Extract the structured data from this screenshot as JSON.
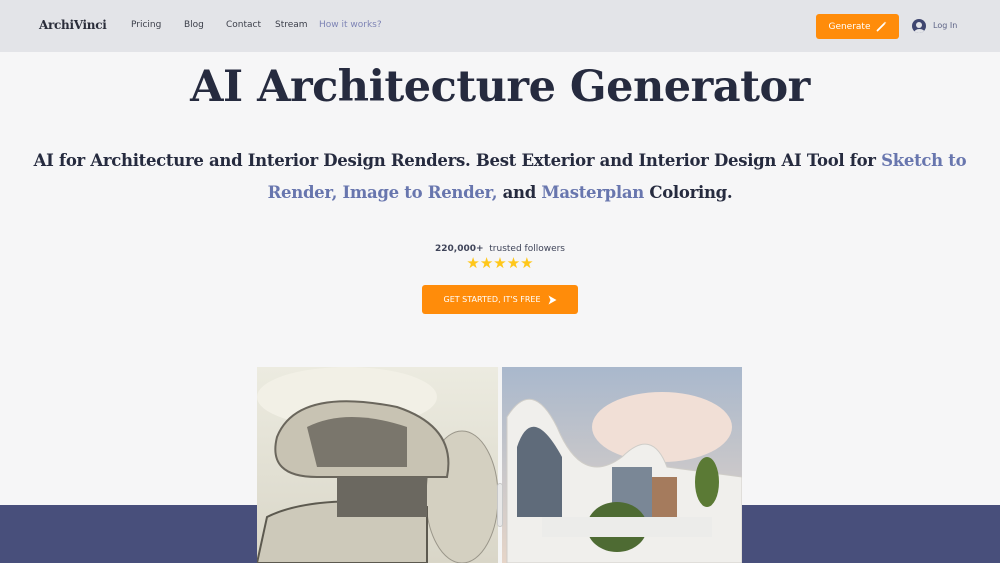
{
  "nav": {
    "logo": "ArchiVinci",
    "links": [
      "Pricing",
      "Blog",
      "Contact",
      "Stream",
      "How it works?"
    ],
    "generate_label": "Generate",
    "login_label": "Log In"
  },
  "hero": {
    "title": "AI Architecture Generator",
    "subtitle_part1": "AI for Architecture and Interior Design Renders. Best Exterior and Interior Design AI Tool for ",
    "subtitle_hl1": "Sketch to Render, Image to Render,",
    "subtitle_part2": " and ",
    "subtitle_hl2": "Masterplan",
    "subtitle_part3": " Coloring.",
    "followers_count": "220,000+",
    "followers_label": "trusted followers",
    "rating_stars": 5,
    "cta_label": "GET STARTED, IT'S FREE"
  },
  "colors": {
    "accent": "#ff8c0a",
    "highlight": "#6876ae",
    "band": "#484f7b",
    "nav_bg": "#e3e4e8"
  }
}
